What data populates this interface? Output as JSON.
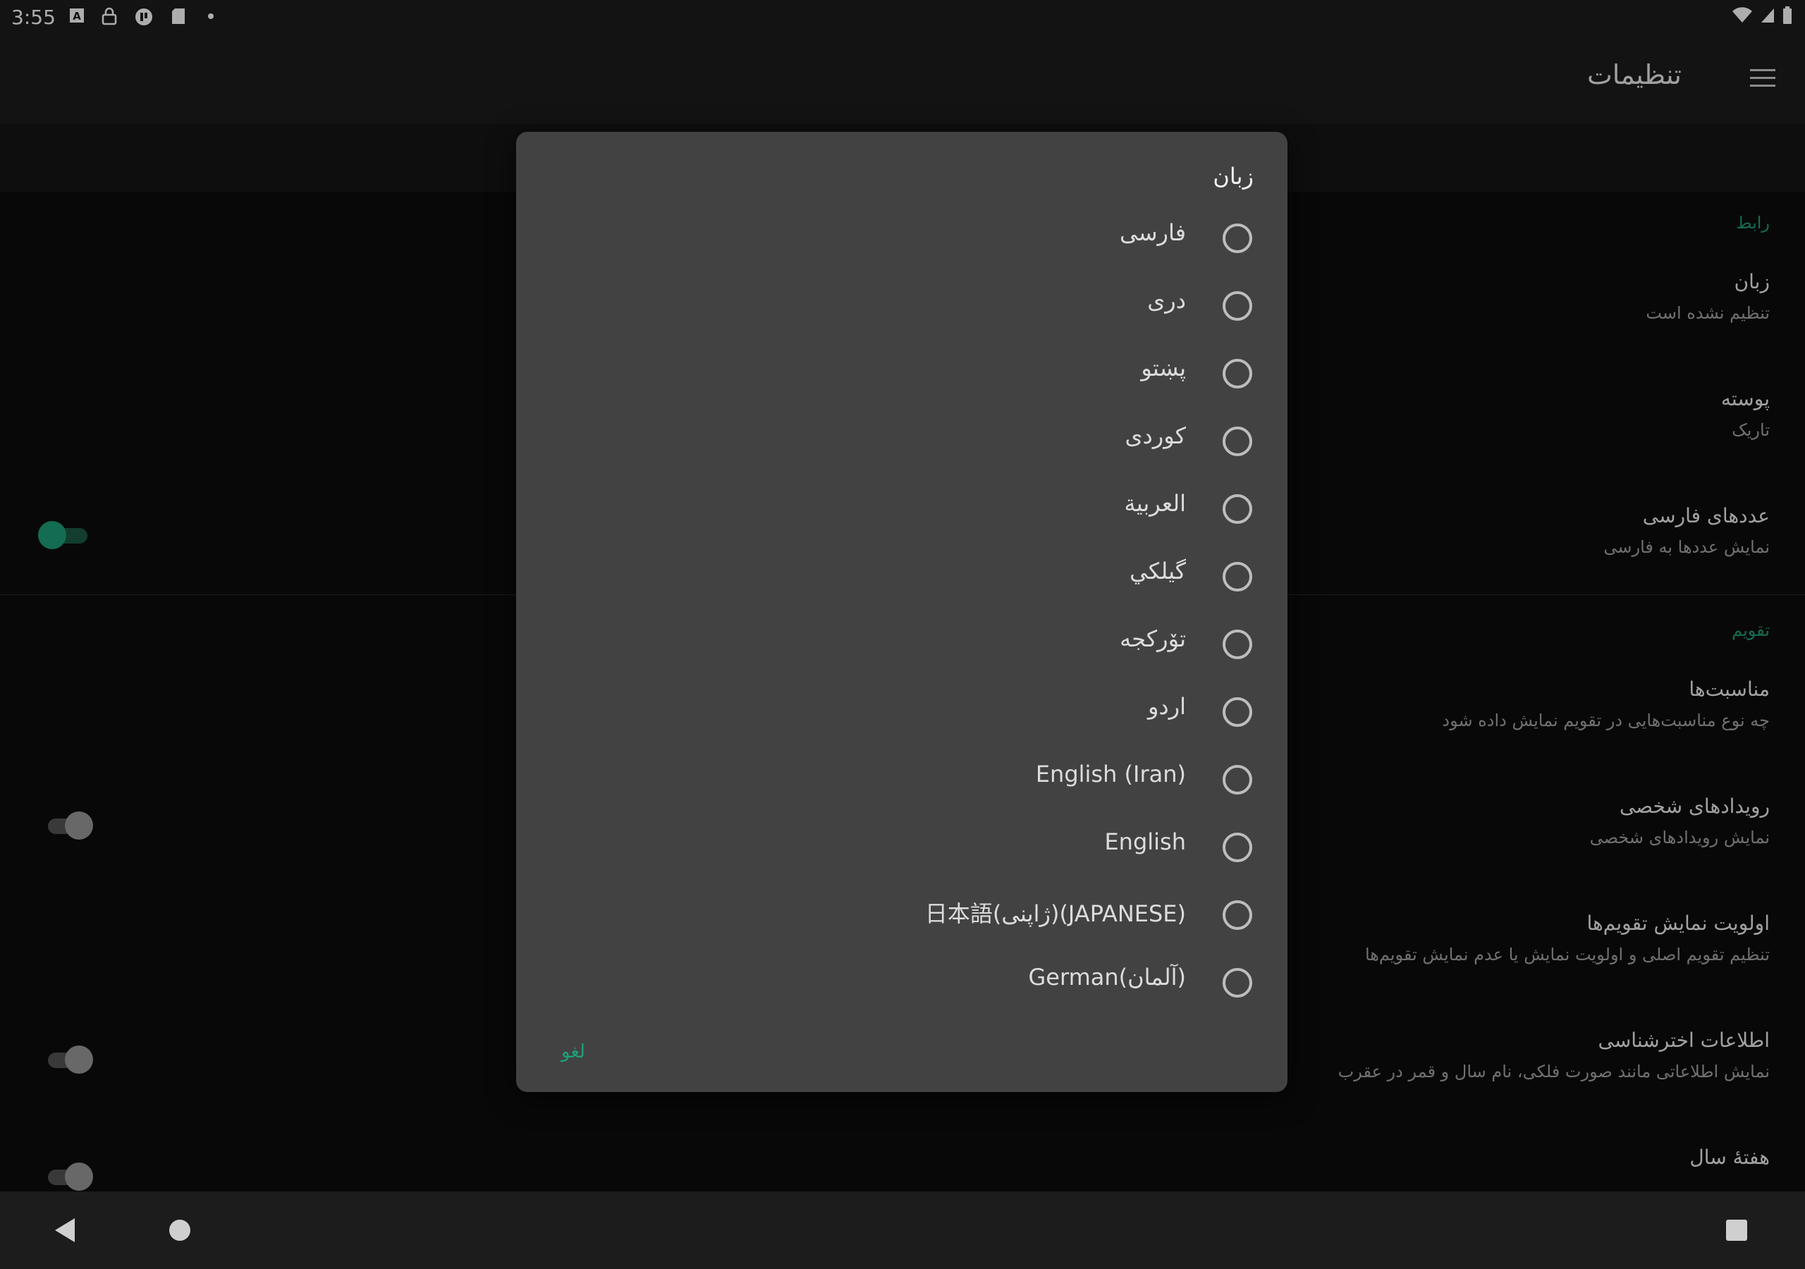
{
  "status_bar": {
    "time": "3:55",
    "icons": [
      "a-icon",
      "lock-icon",
      "app-icon",
      "sdcard-icon",
      "dot-icon"
    ],
    "right_icons": [
      "wifi-icon",
      "signal-icon",
      "battery-icon"
    ]
  },
  "app_bar": {
    "title": "تنظیمات",
    "menu_icon": "menu-icon"
  },
  "settings": {
    "category_interface": "رابط",
    "language": {
      "title": "زبان",
      "summary": "تنظیم نشده است"
    },
    "theme": {
      "title": "پوسته",
      "summary": "تاریک"
    },
    "persian_digits": {
      "title": "عددهای فارسی",
      "summary": "نمایش عددها به فارسی",
      "enabled": true
    },
    "category_calendar": "تقویم",
    "holidays": {
      "title": "مناسبت‌ها",
      "summary": "چه نوع مناسبت‌هایی در تقویم نمایش داده شود"
    },
    "personal_events": {
      "title": "رویدادهای شخصی",
      "summary": "نمایش رویدادهای شخصی",
      "enabled": false
    },
    "calendar_priority": {
      "title": "اولویت نمایش تقویم‌ها",
      "summary": "تنظیم تقویم اصلی و اولویت نمایش یا عدم نمایش تقویم‌ها"
    },
    "astronomy": {
      "title": "اطلاعات اخترشناسی",
      "summary": "نمایش اطلاعاتی مانند صورت فلکی، نام سال و قمر در عقرب",
      "enabled": false
    },
    "week_of_year": {
      "title": "هفتهٔ سال",
      "enabled": false
    }
  },
  "dialog": {
    "title": "زبان",
    "options": [
      "فارسی",
      "دری",
      "پښتو",
      "کوردی",
      "العربية",
      "گیلکي",
      "تۆرکجه",
      "اردو",
      "English (Iran)",
      "English",
      "日本語(ژاپنی)(JAPANESE)",
      "German(آلمان)"
    ],
    "cancel_label": "لغو"
  },
  "colors": {
    "accent": "#1ea07a",
    "dialog_bg": "#424242",
    "bar_bg": "#1c1c1c"
  }
}
